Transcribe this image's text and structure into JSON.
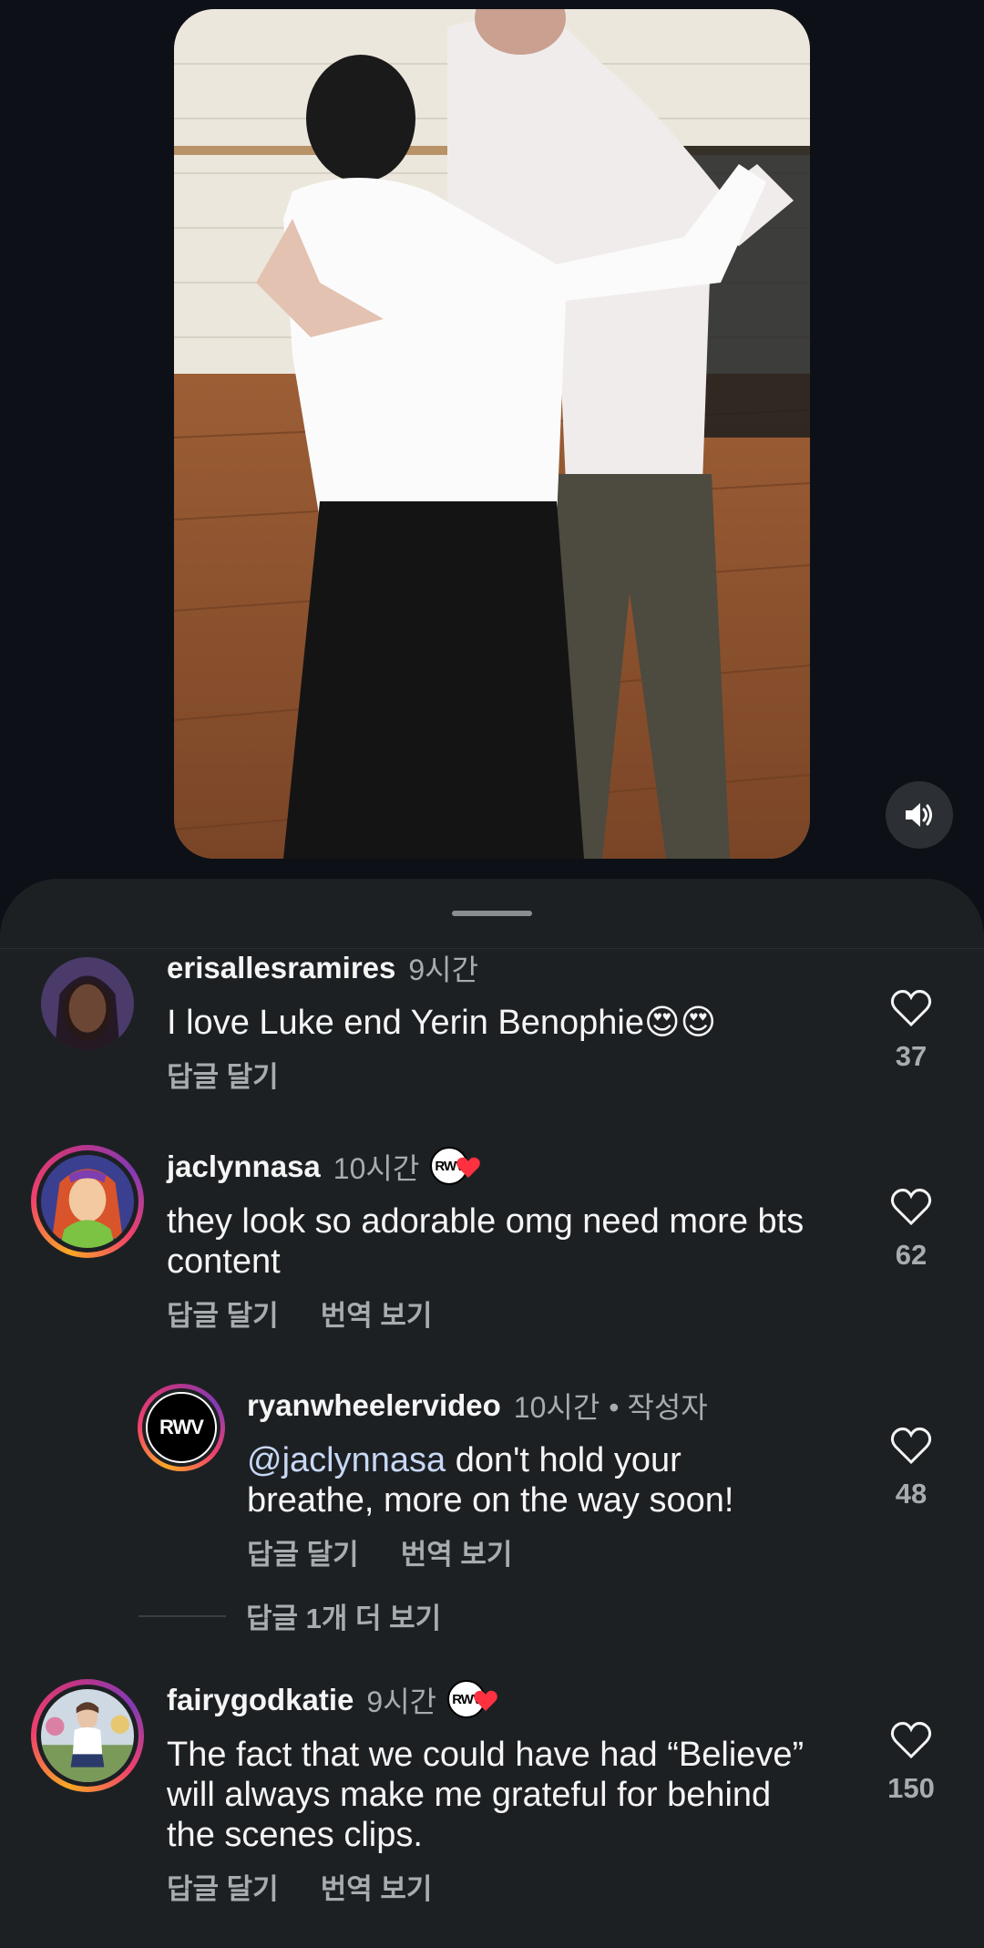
{
  "video": {
    "mute_icon": "speaker-icon"
  },
  "comments": [
    {
      "username": "erisallesramires",
      "time": "9시간",
      "text": "I love Luke end Yerin Benophie😍😍",
      "actions": [
        "답글 달기"
      ],
      "likes": "37"
    },
    {
      "username": "jaclynnasa",
      "time": "10시간",
      "creator_badge": "RWV",
      "text": "they look so adorable omg need more bts content",
      "actions": [
        "답글 달기",
        "번역 보기"
      ],
      "likes": "62"
    },
    {
      "username": "ryanwheelervideo",
      "time": "10시간",
      "author_tag": "• 작성자",
      "avatar_text": "RWV",
      "mention": "@jaclynnasa",
      "text": " don't hold your breathe, more on the way soon!",
      "actions": [
        "답글 달기",
        "번역 보기"
      ],
      "likes": "48"
    },
    {
      "username": "fairygodkatie",
      "time": "9시간",
      "creator_badge": "RWV",
      "text": "The fact that we could have had “Believe” will always make me grateful for behind the scenes clips.",
      "actions": [
        "답글 달기",
        "번역 보기"
      ],
      "likes": "150"
    }
  ],
  "more_replies": "답글 1개 더 보기",
  "colors": {
    "background": "#0d1117",
    "sheet": "#1d2023",
    "secondary_text": "#a8abaf",
    "heart_red": "#ff3040"
  }
}
